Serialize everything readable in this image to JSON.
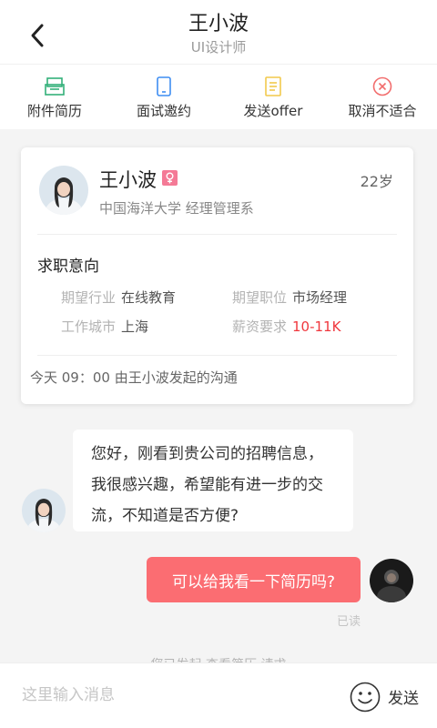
{
  "header": {
    "title": "王小波",
    "subtitle": "UI设计师"
  },
  "actions": [
    {
      "label": "附件简历",
      "icon": "resume-icon",
      "color": "#33b07a"
    },
    {
      "label": "面试邀约",
      "icon": "phone-icon",
      "color": "#3f8ef2"
    },
    {
      "label": "发送offer",
      "icon": "document-icon",
      "color": "#f2c94c"
    },
    {
      "label": "取消不适合",
      "icon": "close-circle-icon",
      "color": "#f26d6d"
    }
  ],
  "profile": {
    "name": "王小波",
    "gender_icon": "female-icon",
    "age": "22岁",
    "school": "中国海洋大学   经理管理系"
  },
  "intent": {
    "title": "求职意向",
    "industry_key": "期望行业",
    "industry_val": "在线教育",
    "position_key": "期望职位",
    "position_val": "市场经理",
    "city_key": "工作城市",
    "city_val": "上海",
    "salary_key": "薪资要求",
    "salary_val": "10-11K"
  },
  "origin": "今天   09：00    由王小波发起的沟通",
  "messages": {
    "incoming_line1": "您好，刚看到贵公司的招聘信息，",
    "incoming_line2": "我很感兴趣，希望能有进一步的交",
    "incoming_line3": "流，不知道是否方便?",
    "outgoing": "可以给我看一下简历吗?",
    "read_status": "已读",
    "system_note": "您已发起 查看简历 请求"
  },
  "input": {
    "placeholder": "这里输入消息",
    "send_label": "发送"
  },
  "colors": {
    "accent": "#fb6d72",
    "salary": "#f0373d"
  }
}
